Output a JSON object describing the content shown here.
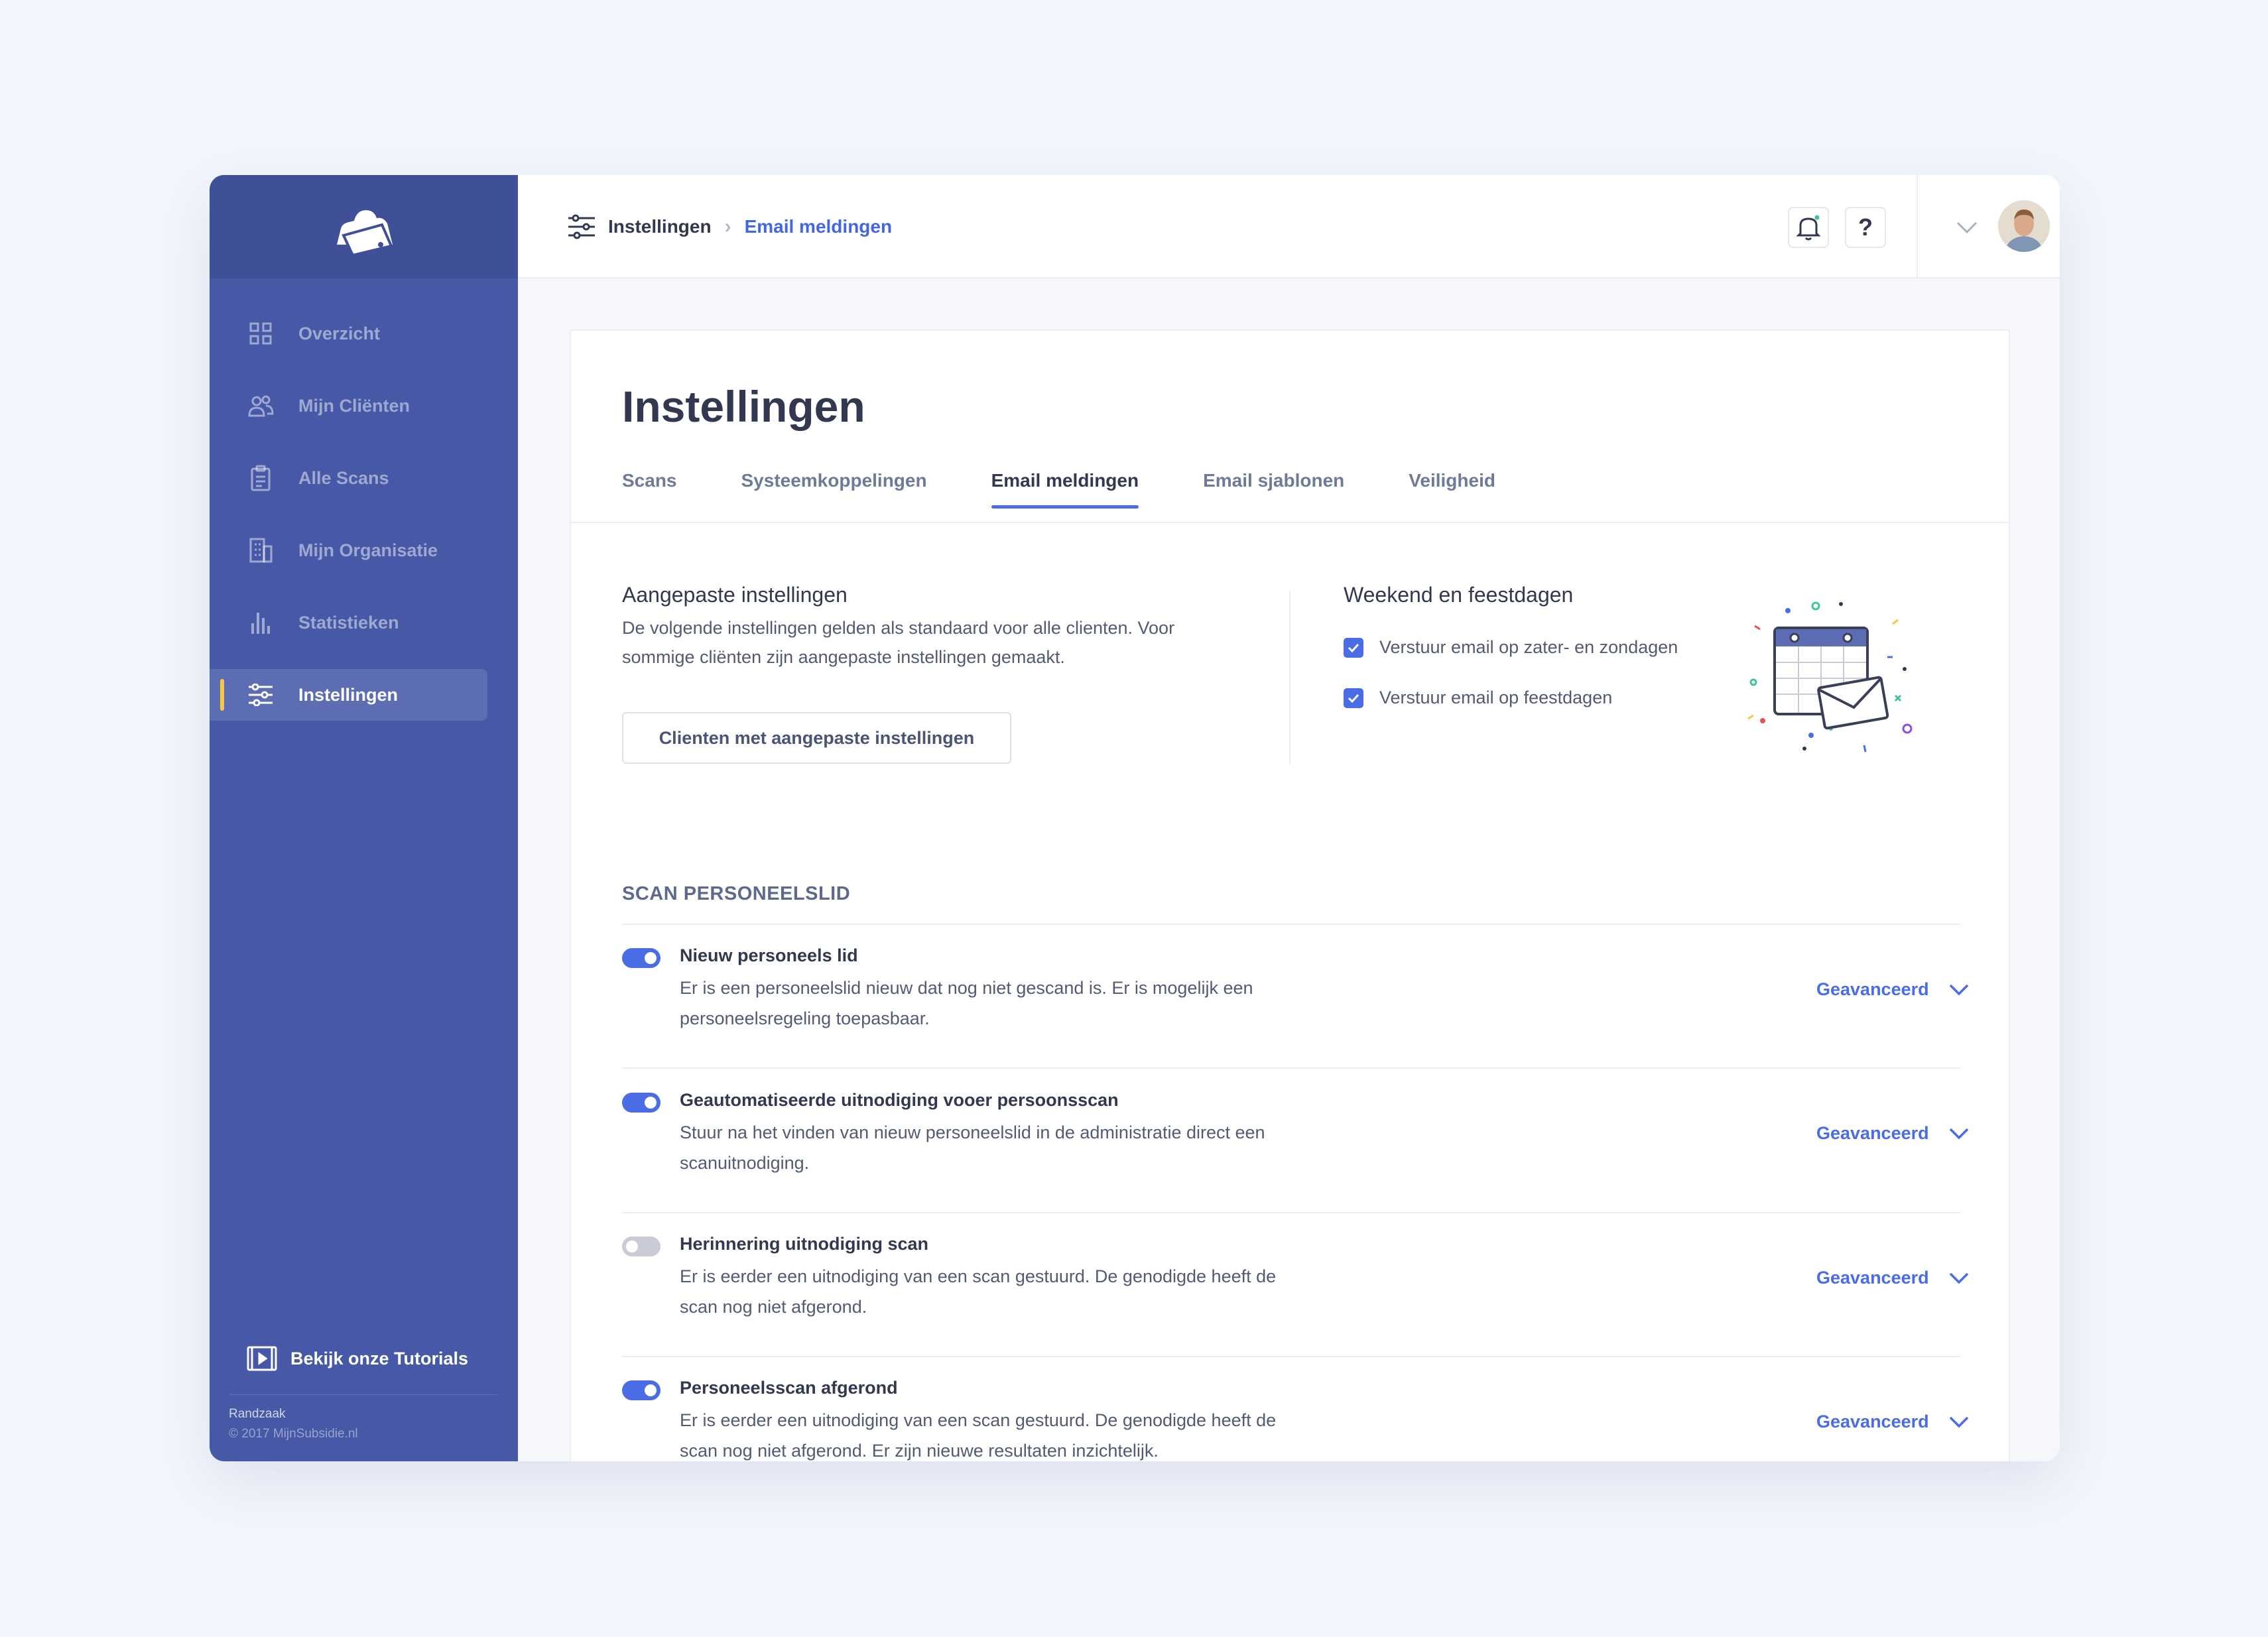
{
  "colors": {
    "sidebar": "#4658a6",
    "accent": "#4a6de6",
    "active_marker": "#f6c744"
  },
  "sidebar": {
    "items": [
      {
        "label": "Overzicht",
        "icon": "grid-icon"
      },
      {
        "label": "Mijn Cliënten",
        "icon": "users-icon"
      },
      {
        "label": "Alle Scans",
        "icon": "clipboard-icon"
      },
      {
        "label": "Mijn Organisatie",
        "icon": "building-icon"
      },
      {
        "label": "Statistieken",
        "icon": "bar-chart-icon"
      },
      {
        "label": "Instellingen",
        "icon": "sliders-icon",
        "active": true
      }
    ],
    "tutorials": "Bekijk onze Tutorials",
    "company": "Randzaak",
    "copyright": "© 2017 MijnSubsidie.nl"
  },
  "topbar": {
    "breadcrumb_root": "Instellingen",
    "breadcrumb_separator": "›",
    "breadcrumb_current": "Email meldingen",
    "help": "?"
  },
  "main": {
    "title": "Instellingen",
    "tabs": [
      {
        "label": "Scans"
      },
      {
        "label": "Systeemkoppelingen"
      },
      {
        "label": "Email meldingen",
        "active": true
      },
      {
        "label": "Email sjablonen"
      },
      {
        "label": "Veiligheid"
      }
    ],
    "custom": {
      "title": "Aangepaste instellingen",
      "desc_line1": "De volgende instellingen gelden als standaard voor alle clienten. Voor",
      "desc_line2": "sommige cliënten zijn aangepaste instellingen gemaakt.",
      "button": "Clienten met aangepaste instellingen"
    },
    "weekend": {
      "title": "Weekend en feestdagen",
      "options": [
        {
          "label": "Verstuur email op zater- en zondagen",
          "checked": true
        },
        {
          "label": "Verstuur email op feestdagen",
          "checked": true
        }
      ]
    },
    "section_heading": "SCAN PERSONEELSLID",
    "advanced_label": "Geavanceerd",
    "rows": [
      {
        "title": "Nieuw personeels lid",
        "desc1": "Er is een personeelslid nieuw dat nog niet gescand is. Er is mogelijk een",
        "desc2": "personeelsregeling toepasbaar.",
        "enabled": true
      },
      {
        "title": "Geautomatiseerde uitnodiging vooer persoonsscan",
        "desc1": "Stuur na het vinden van nieuw personeelslid in de administratie direct een",
        "desc2": "scanuitnodiging.",
        "enabled": true
      },
      {
        "title": "Herinnering uitnodiging scan",
        "desc1": "Er is eerder een uitnodiging van een scan gestuurd. De genodigde heeft de",
        "desc2": "scan nog niet afgerond.",
        "enabled": false
      },
      {
        "title": "Personeelsscan afgerond",
        "desc1": "Er is eerder een uitnodiging van een scan gestuurd. De genodigde heeft de",
        "desc2": "scan nog niet afgerond. Er zijn nieuwe resultaten inzichtelijk.",
        "enabled": true
      }
    ]
  }
}
